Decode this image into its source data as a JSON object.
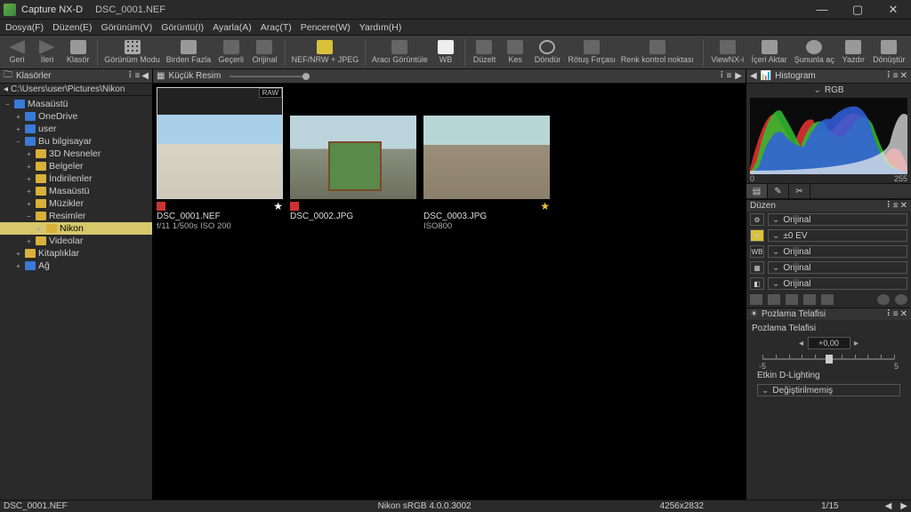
{
  "titlebar": {
    "app": "Capture NX-D",
    "doc": "DSC_0001.NEF"
  },
  "menubar": [
    "Dosya(F)",
    "Düzen(E)",
    "Görünüm(V)",
    "Görüntü(I)",
    "Ayarla(A)",
    "Araç(T)",
    "Pencere(W)",
    "Yardım(H)"
  ],
  "toolbar": {
    "back": "Geri",
    "forward": "İleri",
    "folder": "Klasör",
    "viewmode": "Görünüm Modu",
    "multi": "Birden Fazla",
    "current": "Geçerli",
    "original": "Orijinal",
    "nefjpeg": "NEF/NRW + JPEG",
    "tool": "Aracı Görüntüle",
    "wb": "WB",
    "straighten": "Düzelt",
    "crop": "Kes",
    "rotate": "Döndür",
    "retouch": "Rötuş Fırçası",
    "colorctl": "Renk kontrol noktası",
    "viewnxi": "ViewNX-i",
    "export": "İçeri Aktar",
    "web": "Şununla aç",
    "print": "Yazdır",
    "convert": "Dönüştür"
  },
  "left": {
    "header": "Klasörler",
    "path": "C:\\Users\\user\\Pictures\\Nikon",
    "tree": {
      "desktop": "Masaüstü",
      "onedrive": "OneDrive",
      "user": "user",
      "thispc": "Bu bilgisayar",
      "objects3d": "3D Nesneler",
      "docs": "Belgeler",
      "downloads": "İndirilenler",
      "desktop2": "Masaüstü",
      "music": "Müzikler",
      "pictures": "Resimler",
      "nikon": "Nikon",
      "videos": "Videolar",
      "libraries": "Kitaplıklar",
      "network": "Ağ"
    }
  },
  "center": {
    "headerLabel": "Küçük Resim",
    "rawBadge": "RAW",
    "thumbs": [
      {
        "filename": "DSC_0001.NEF",
        "info": "f/11 1/500s ISO 200",
        "star": "white",
        "flag": true
      },
      {
        "filename": "DSC_0002.JPG",
        "info": "",
        "star": "",
        "flag": true
      },
      {
        "filename": "DSC_0003.JPG",
        "info": "ISO800",
        "star": "gold",
        "flag": false
      }
    ]
  },
  "right": {
    "histogram": {
      "label": "Histogram",
      "channel": "RGB",
      "axisMin": "0",
      "axisMax": "255"
    },
    "layout": {
      "header": "Düzen",
      "rows": [
        {
          "icon": "⚙",
          "value": "Orijinal"
        },
        {
          "icon": "☀",
          "value": "±0 EV"
        },
        {
          "icon": "WB",
          "value": "Orijinal"
        },
        {
          "icon": "▦",
          "value": "Orijinal"
        },
        {
          "icon": "◧",
          "value": "Orijinal"
        }
      ]
    },
    "exposure": {
      "header": "Pozlama Telafisi",
      "label": "Pozlama Telafisi",
      "value": "+0,00",
      "min": "-5",
      "max": "5"
    },
    "dlighting": {
      "label": "Etkin D-Lighting",
      "value": "Değiştirilmemiş"
    }
  },
  "statusbar": {
    "filename": "DSC_0001.NEF",
    "colorspace": "Nikon sRGB 4.0.0.3002",
    "dims": "4256x2832",
    "page": "1/15"
  }
}
